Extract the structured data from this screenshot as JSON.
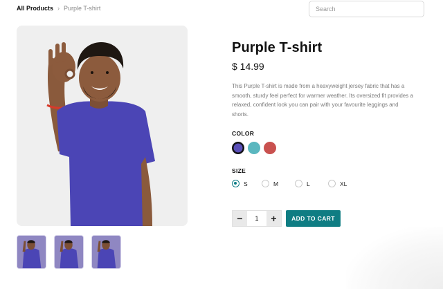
{
  "breadcrumb": {
    "root": "All Products",
    "separator": "›",
    "current": "Purple T-shirt"
  },
  "search": {
    "placeholder": "Search",
    "icon": "none"
  },
  "product": {
    "title": "Purple T-shirt",
    "price": "$ 14.99",
    "description": "This Purple T-shirt is made from a heavyweight jersey fabric that has a smooth, sturdy feel perfect for warmer weather. Its oversized fit provides a relaxed, confident look you can pair with your favourite leggings and shorts.",
    "main_image_alt": "Man wearing purple t-shirt making OK gesture",
    "thumbnail_count": 3
  },
  "color": {
    "label": "COLOR",
    "options": [
      {
        "name": "purple",
        "hex": "#5a4fb8",
        "selected": true
      },
      {
        "name": "teal",
        "hex": "#5ab7bf",
        "selected": false
      },
      {
        "name": "red",
        "hex": "#c9514f",
        "selected": false
      }
    ]
  },
  "size": {
    "label": "SIZE",
    "options": [
      "S",
      "M",
      "L",
      "XL"
    ],
    "selected": "S"
  },
  "quantity": {
    "minus": "−",
    "value": "1",
    "plus": "+"
  },
  "cart": {
    "add_label": "ADD TO CART"
  },
  "colors": {
    "accent": "#0f7d83",
    "shirt": "#4b45b5"
  }
}
